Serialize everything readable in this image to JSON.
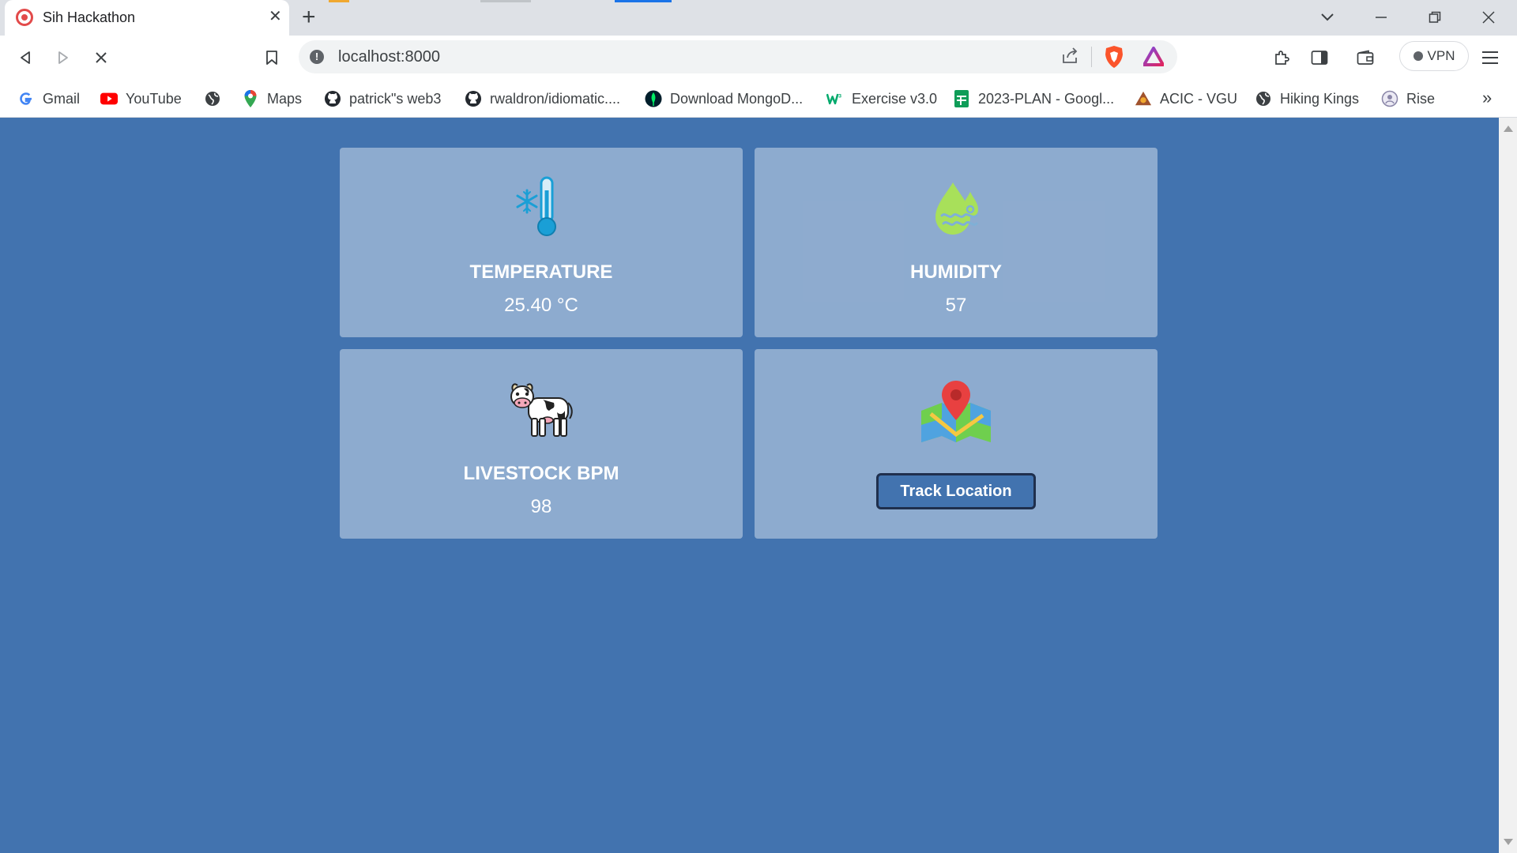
{
  "browser": {
    "tab": {
      "title": "Sih Hackathon"
    },
    "url": "localhost:8000",
    "vpn_label": "VPN",
    "bookmarks": [
      {
        "label": "Gmail",
        "icon": "google-icon"
      },
      {
        "label": "YouTube",
        "icon": "youtube-icon"
      },
      {
        "label": "",
        "icon": "globe-icon"
      },
      {
        "label": "Maps",
        "icon": "maps-icon"
      },
      {
        "label": "patrick\"s web3",
        "icon": "github-icon"
      },
      {
        "label": "rwaldron/idiomatic....",
        "icon": "github-icon"
      },
      {
        "label": "Download MongoD...",
        "icon": "mongodb-leaf-icon"
      },
      {
        "label": "Exercise v3.0",
        "icon": "w3schools-icon"
      },
      {
        "label": "2023-PLAN - Googl...",
        "icon": "sheets-icon"
      },
      {
        "label": "ACIC - VGU",
        "icon": "acic-icon"
      },
      {
        "label": "Hiking Kings",
        "icon": "globe-icon"
      },
      {
        "label": "Rise",
        "icon": "rise-icon"
      }
    ]
  },
  "dashboard": {
    "temperature": {
      "label": "TEMPERATURE",
      "value": "25.40 °C",
      "icon": "thermometer-icon"
    },
    "humidity": {
      "label": "HUMIDITY",
      "value": "57",
      "icon": "humidity-drop-icon"
    },
    "livestock": {
      "label": "LIVESTOCK BPM",
      "value": "98",
      "icon": "cow-icon"
    },
    "location": {
      "button_label": "Track Location",
      "icon": "map-pin-icon"
    }
  },
  "colors": {
    "page_background": "#4273af",
    "card_background": "rgba(255,255,255,0.4)",
    "button_background": "#4273af"
  }
}
